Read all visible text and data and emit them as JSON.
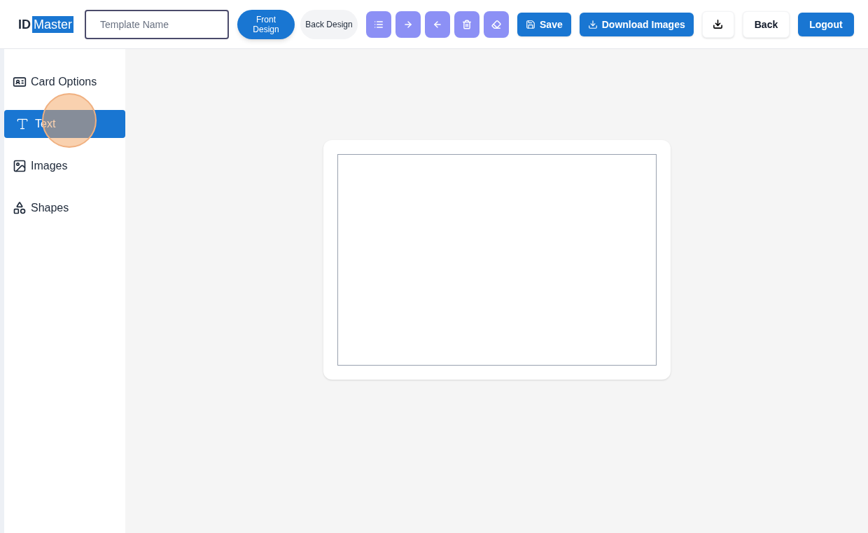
{
  "logo": {
    "prefix": "ID",
    "highlight": "Master"
  },
  "template_name": {
    "placeholder": "Template Name"
  },
  "design_tabs": [
    {
      "label": "Front Design",
      "selected": true
    },
    {
      "label": "Back Design",
      "selected": false
    }
  ],
  "tool_buttons": [
    {
      "kind": "list"
    },
    {
      "kind": "forward"
    },
    {
      "kind": "backward"
    },
    {
      "kind": "delete"
    },
    {
      "kind": "erase"
    }
  ],
  "actions": [
    {
      "kind": "save",
      "label": "Save"
    },
    {
      "kind": "download",
      "label": "Download Images"
    },
    {
      "kind": "download-small"
    },
    {
      "kind": "back",
      "label": "Back"
    },
    {
      "kind": "logout",
      "label": "Logout"
    }
  ],
  "sidebar": {
    "items": [
      {
        "kind": "card",
        "label": "Card Options",
        "selected": false
      },
      {
        "kind": "text",
        "label": "Text",
        "selected": true
      },
      {
        "kind": "images",
        "label": "Images",
        "selected": false
      },
      {
        "kind": "shapes",
        "label": "Shapes",
        "selected": false
      }
    ]
  }
}
